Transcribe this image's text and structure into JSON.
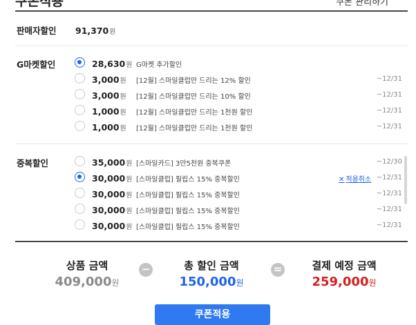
{
  "header": {
    "title": "쿠폰적용",
    "right_text": "쿠폰 관리하기",
    "chevron": "chevron-right-icon"
  },
  "seller": {
    "label": "판매자할인",
    "amount": "91,370",
    "unit": "원"
  },
  "gmarket": {
    "label": "G마켓할인",
    "options": [
      {
        "amount": "28,630",
        "unit": "원",
        "desc": "G마켓 추가할인",
        "date": "",
        "checked": true
      },
      {
        "amount": "3,000",
        "unit": "원",
        "desc": "[12월] 스마일클럽만 드리는 12% 할인",
        "date": "~12/31",
        "checked": false
      },
      {
        "amount": "3,000",
        "unit": "원",
        "desc": "[12월] 스마일클럽만 드리는 10% 할인",
        "date": "~12/31",
        "checked": false
      },
      {
        "amount": "1,000",
        "unit": "원",
        "desc": "[12월] 스마일클럽만 드리는 1천원 할인",
        "date": "~12/31",
        "checked": false
      },
      {
        "amount": "1,000",
        "unit": "원",
        "desc": "[12월] 스마일클럽만 드리는 1천원 할인",
        "date": "~12/31",
        "checked": false
      }
    ]
  },
  "duplicate": {
    "label": "중복할인",
    "cancel_label": "적용취소",
    "options": [
      {
        "amount": "35,000",
        "unit": "원",
        "desc": "[스마일카드] 3만5천원 중복쿠폰",
        "date": "~12/30",
        "checked": false
      },
      {
        "amount": "30,000",
        "unit": "원",
        "desc": "[스마일클럽] 필립스 15% 중복할인",
        "date": "~12/31",
        "checked": true
      },
      {
        "amount": "30,000",
        "unit": "원",
        "desc": "[스마일클럽] 필립스 15% 중복할인",
        "date": "~12/31",
        "checked": false
      },
      {
        "amount": "30,000",
        "unit": "원",
        "desc": "[스마일클럽] 필립스 15% 중복할인",
        "date": "~12/31",
        "checked": false
      },
      {
        "amount": "30,000",
        "unit": "원",
        "desc": "[스마일클럽] 필립스 15% 중복할인",
        "date": "~12/31",
        "checked": false
      }
    ]
  },
  "summary": {
    "product_label": "상품 금액",
    "product_value": "409,000",
    "discount_label": "총 할인 금액",
    "discount_value": "150,000",
    "pay_label": "결제 예정 금액",
    "pay_value": "259,000",
    "unit": "원",
    "minus": "−",
    "equals": "="
  },
  "apply_button": "쿠폰적용",
  "colors": {
    "accent": "#1e63e9",
    "button": "#2f7af0",
    "red": "#d11f1f",
    "gray": "#8a8a8a"
  }
}
